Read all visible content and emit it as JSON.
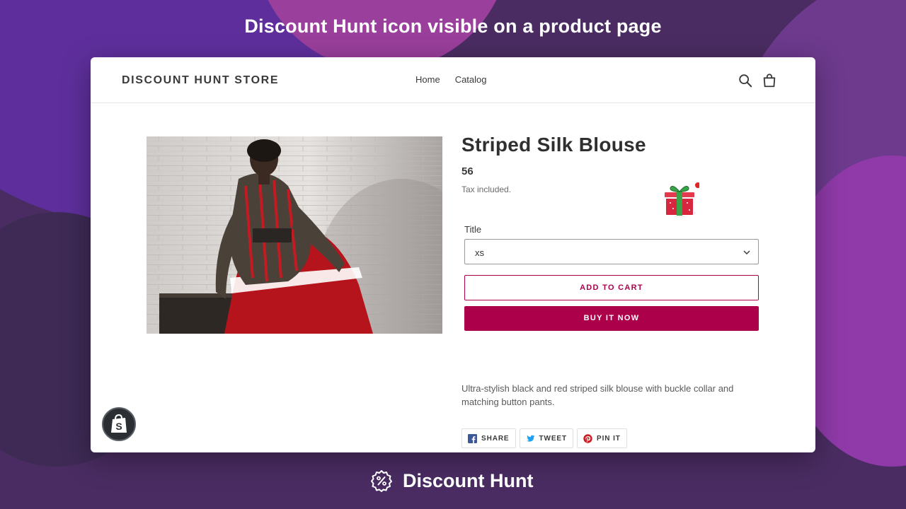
{
  "headline": "Discount Hunt icon visible on a product page",
  "store": {
    "logo": "DISCOUNT HUNT STORE",
    "nav": [
      "Home",
      "Catalog"
    ],
    "icons": [
      "search-icon",
      "cart-icon"
    ]
  },
  "product": {
    "title": "Striped Silk Blouse",
    "price": "56",
    "tax_note": "Tax included.",
    "option_label": "Title",
    "option_value": "xs",
    "add_to_cart": "ADD TO CART",
    "buy_now": "BUY IT NOW",
    "description": "Ultra-stylish black and red striped silk blouse with buckle collar and matching button pants.",
    "share": [
      "SHARE",
      "TWEET",
      "PIN IT"
    ]
  },
  "widget": {
    "icon": "gift-icon"
  },
  "footer": {
    "brand": "Discount Hunt",
    "icon": "discount-badge-icon"
  },
  "colors": {
    "accent": "#ad004b",
    "background": "#4a2c62"
  }
}
